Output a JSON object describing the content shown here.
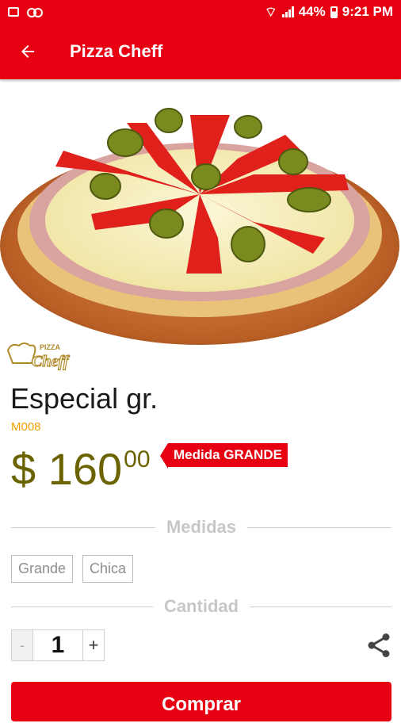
{
  "status_bar": {
    "battery": "44%",
    "time": "9:21 PM",
    "icons": [
      "image-icon",
      "voicemail-icon",
      "wifi-icon",
      "signal-icon",
      "battery-icon"
    ]
  },
  "app_bar": {
    "title": "Pizza Cheff",
    "back_icon": "arrow-left-icon"
  },
  "product": {
    "name": "Especial gr.",
    "code": "M008",
    "currency": "$",
    "price_int": "160",
    "price_cents": "00",
    "size_badge": "Medida GRANDE"
  },
  "logo": {
    "line1": "PIZZA",
    "line2": "Cheff"
  },
  "sections": {
    "sizes_label": "Medidas",
    "quantity_label": "Cantidad"
  },
  "sizes": [
    "Grande",
    "Chica"
  ],
  "quantity": {
    "minus": "-",
    "value": "1",
    "plus": "+"
  },
  "actions": {
    "buy_label": "Comprar",
    "share_icon": "share-icon"
  },
  "colors": {
    "accent": "#e60012",
    "price": "#6b6300",
    "code": "#f0a000"
  }
}
